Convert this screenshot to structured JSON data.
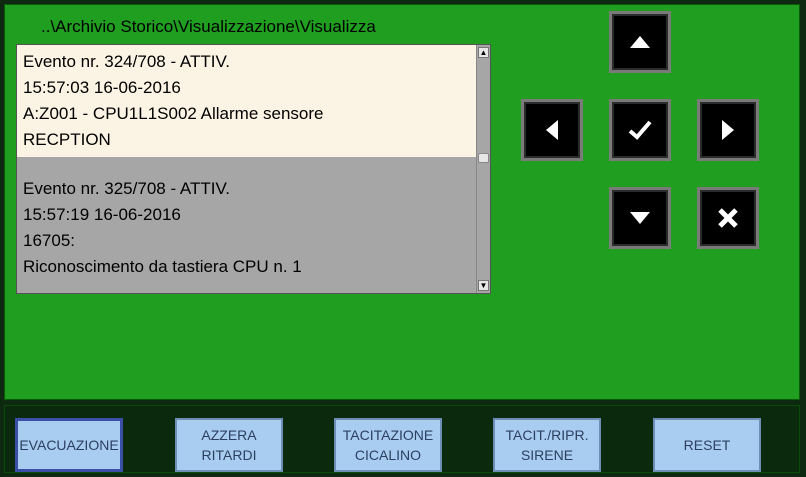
{
  "breadcrumb": "..\\Archivio Storico\\Visualizzazione\\Visualizza",
  "events": [
    {
      "lines": [
        "Evento nr. 324/708 - ATTIV.",
        "15:57:03 16-06-2016",
        "A:Z001 - CPU1L1S002 Allarme sensore",
        "RECPTION"
      ],
      "selected": true
    },
    {
      "lines": [
        "Evento nr. 325/708 - ATTIV.",
        "15:57:19 16-06-2016",
        "16705:",
        "Riconoscimento da tastiera CPU n. 1"
      ],
      "selected": false
    }
  ],
  "nav_buttons": {
    "up": "up-arrow-icon",
    "left": "left-arrow-icon",
    "confirm": "checkmark-icon",
    "right": "right-arrow-icon",
    "down": "down-arrow-icon",
    "cancel": "cross-icon"
  },
  "function_buttons": [
    {
      "label": "EVACUAZIONE"
    },
    {
      "label": "AZZERA\nRITARDI"
    },
    {
      "label": "TACITAZIONE\nCICALINO"
    },
    {
      "label": "TACIT./RIPR.\nSIRENE"
    },
    {
      "label": "RESET"
    }
  ],
  "colors": {
    "background": "#1f9e1f",
    "selected_event": "#fbf4e4",
    "event_bg": "#a6a6a6",
    "function_button": "#a9cdf0"
  }
}
